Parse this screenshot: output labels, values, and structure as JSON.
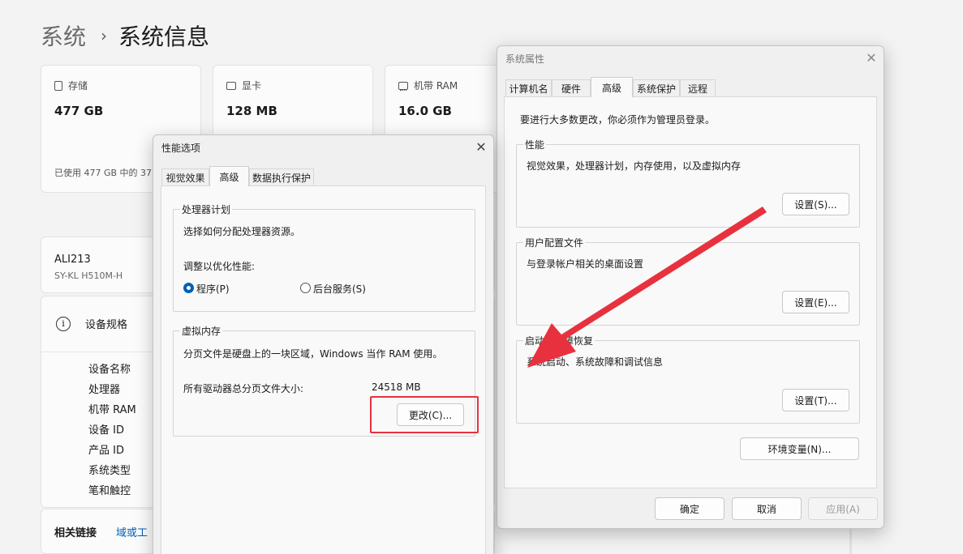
{
  "settings": {
    "breadcrumb_parent": "系统",
    "breadcrumb_sep": "›",
    "breadcrumb_current": "系统信息",
    "storage": {
      "label": "存储",
      "value": "477 GB",
      "footer": "已使用 477 GB 中的 37"
    },
    "gpu": {
      "label": "显卡",
      "value": "128 MB"
    },
    "ram": {
      "label": "机带 RAM",
      "value": "16.0 GB"
    },
    "device_name": "ALI213",
    "device_model": "SY-KL H510M-H",
    "spec_section_title": "设备规格",
    "spec_labels": [
      "设备名称",
      "处理器",
      "机带 RAM",
      "设备 ID",
      "产品 ID",
      "系统类型",
      "笔和触控"
    ],
    "related_title": "相关链接",
    "related_link": "域或工"
  },
  "perf_dialog": {
    "title": "性能选项",
    "close": "✕",
    "tabs": [
      "视觉效果",
      "高级",
      "数据执行保护"
    ],
    "active_tab": "高级",
    "processor_group": "处理器计划",
    "processor_desc": "选择如何分配处理器资源。",
    "optimize_label": "调整以优化性能:",
    "radio_program": "程序(P)",
    "radio_background": "后台服务(S)",
    "selected_radio": "程序(P)",
    "vm_group": "虚拟内存",
    "vm_desc": "分页文件是硬盘上的一块区域，Windows 当作 RAM 使用。",
    "vm_size_label": "所有驱动器总分页文件大小:",
    "vm_size_value": "24518 MB",
    "change_button": "更改(C)..."
  },
  "sys_dialog": {
    "title": "系统属性",
    "close": "✕",
    "tabs": [
      "计算机名",
      "硬件",
      "高级",
      "系统保护",
      "远程"
    ],
    "active_tab": "高级",
    "admin_note": "要进行大多数更改，你必须作为管理员登录。",
    "perf_group": "性能",
    "perf_desc": "视觉效果，处理器计划，内存使用，以及虚拟内存",
    "perf_button": "设置(S)...",
    "profile_group": "用户配置文件",
    "profile_desc": "与登录帐户相关的桌面设置",
    "profile_button": "设置(E)...",
    "startup_group": "启动和故障恢复",
    "startup_desc": "系统启动、系统故障和调试信息",
    "startup_button": "设置(T)...",
    "env_button": "环境变量(N)...",
    "ok_button": "确定",
    "cancel_button": "取消",
    "apply_button": "应用(A)"
  },
  "annotation": {
    "color": "#e8313f"
  }
}
